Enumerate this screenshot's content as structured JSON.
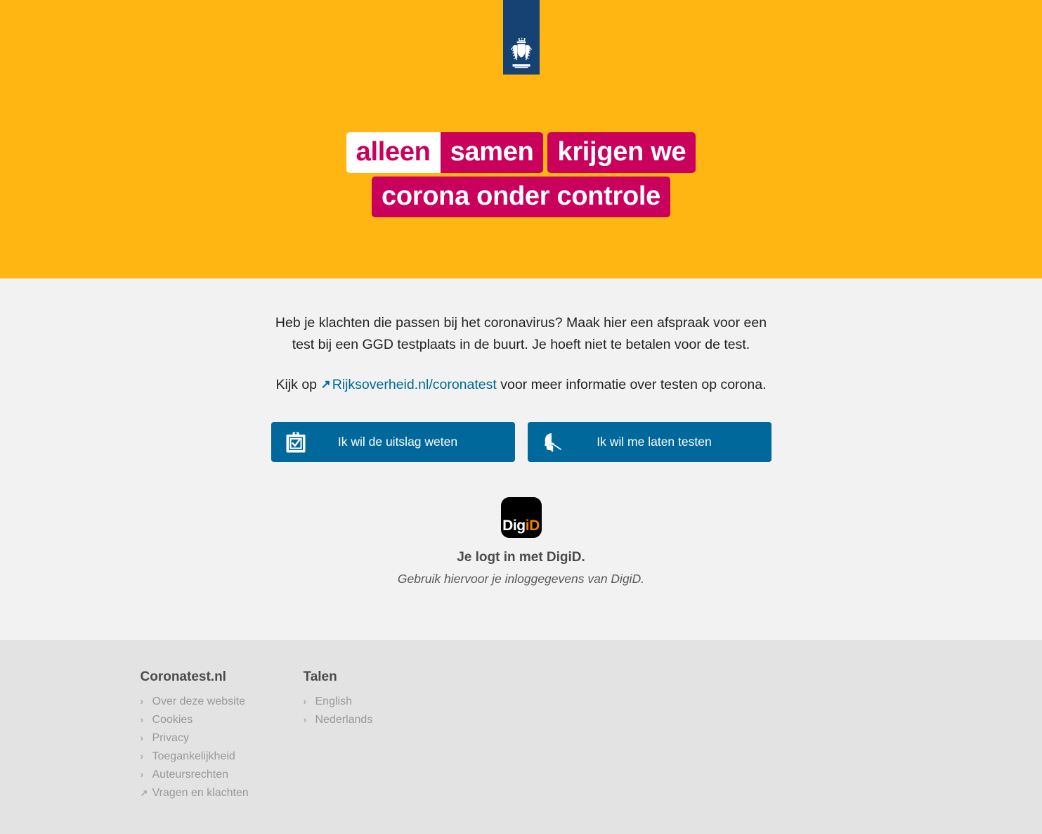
{
  "colors": {
    "header_bg": "#ffb612",
    "logo_bar_bg": "#154273",
    "campaign_magenta": "#ca005d",
    "body_bg": "#f2f2f2",
    "button_blue": "#01689b",
    "footer_bg": "#e3e3e3",
    "digid_black": "#000000",
    "digid_orange": "#f07d00"
  },
  "header": {
    "logo_name": "rijksoverheid-coat-of-arms",
    "campaign": {
      "line1": [
        {
          "text": "alleen",
          "style": "white"
        },
        {
          "text": "samen",
          "style": "magenta"
        },
        {
          "text": "krijgen we",
          "style": "magenta"
        }
      ],
      "line2": [
        {
          "text": "corona onder controle",
          "style": "magenta"
        }
      ]
    }
  },
  "main": {
    "intro_paragraph": "Heb je klachten die passen bij het coronavirus? Maak hier een afspraak voor een test bij een GGD testplaats in de buurt. Je hoeft niet te betalen voor de test.",
    "link_line": {
      "prefix": "Kijk op",
      "link_text": "Rijksoverheid.nl/coronatest",
      "suffix": "voor meer informatie over testen op corona."
    },
    "buttons": [
      {
        "label": "Ik wil de uitslag weten",
        "icon": "clipboard-check-icon"
      },
      {
        "label": "Ik wil me laten testen",
        "icon": "head-swab-icon"
      }
    ],
    "digid": {
      "logo_part1": "Dig",
      "logo_part2": "iD",
      "title": "Je logt in met DigiD.",
      "subtitle": "Gebruik hiervoor je inloggegevens van DigiD."
    }
  },
  "footer": {
    "columns": [
      {
        "heading": "Coronatest.nl",
        "links": [
          {
            "label": "Over deze website",
            "icon": "chevron-right-icon"
          },
          {
            "label": "Cookies",
            "icon": "chevron-right-icon"
          },
          {
            "label": "Privacy",
            "icon": "chevron-right-icon"
          },
          {
            "label": "Toegankelijkheid",
            "icon": "chevron-right-icon"
          },
          {
            "label": "Auteursrechten",
            "icon": "chevron-right-icon"
          },
          {
            "label": "Vragen en klachten",
            "icon": "external-link-icon"
          }
        ]
      },
      {
        "heading": "Talen",
        "links": [
          {
            "label": "English",
            "icon": "chevron-right-icon"
          },
          {
            "label": "Nederlands",
            "icon": "chevron-right-icon"
          }
        ]
      }
    ]
  },
  "icons": {
    "chevron_right": "›",
    "external_link": "↗"
  }
}
